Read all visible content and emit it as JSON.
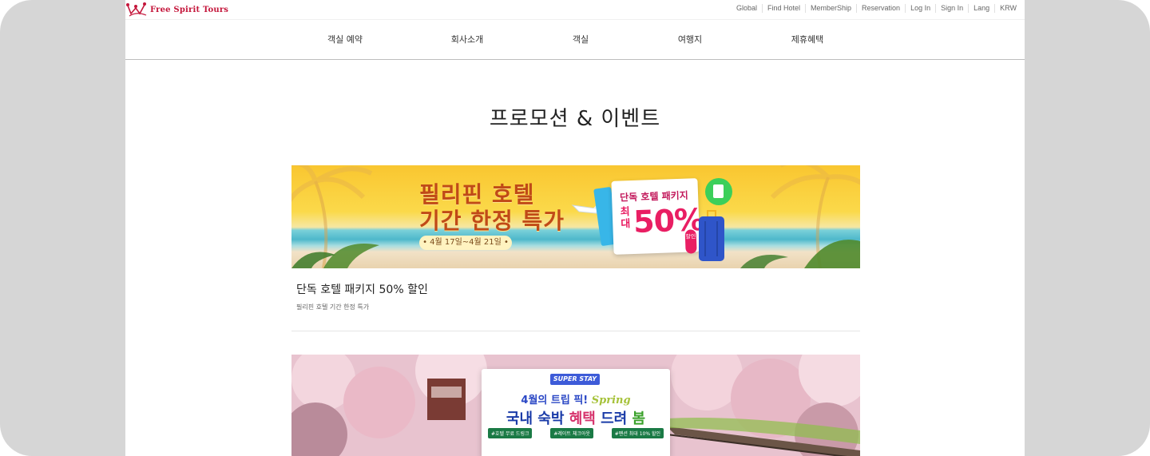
{
  "header": {
    "logo_text": "Free Spirit Tours",
    "utility_links": [
      "Global",
      "Find Hotel",
      "MemberShip",
      "Reservation",
      "Log In",
      "Sign In",
      "Lang",
      "KRW"
    ]
  },
  "nav": {
    "items": [
      "객실 예약",
      "회사소개",
      "객실",
      "여행지",
      "제휴혜택"
    ]
  },
  "page": {
    "title": "프로모션 & 이벤트"
  },
  "promotions": [
    {
      "title": "단독 호텔 패키지 50% 할인",
      "subtitle": "필리핀 호텔 기간 한정 특가",
      "banner": {
        "headline_line1": "필리핀 호텔",
        "headline_line2": "기간 한정 특가",
        "date": "• 4월 17일~4월 21일 •",
        "ticket_label": "단독 호텔 패키지",
        "ticket_max": "최대",
        "ticket_percent": "50%",
        "ticket_sale": "할인"
      }
    },
    {
      "banner": {
        "brand": "SUPER STAY",
        "line1_prefix": "4월의 트립 픽!",
        "line1_spring": "Spring",
        "line2_prefix": "국내 숙박",
        "line2_accent": "혜택",
        "line2_mid": "드려",
        "line2_end": "봄",
        "tags": [
          "#호텔 무료 드링크",
          "#레이트 체크아웃",
          "#펜션 최대 10% 할인"
        ]
      }
    }
  ],
  "colors": {
    "brand": "#c4163b",
    "accent_pink": "#e91e63",
    "blue": "#2a47c5"
  }
}
